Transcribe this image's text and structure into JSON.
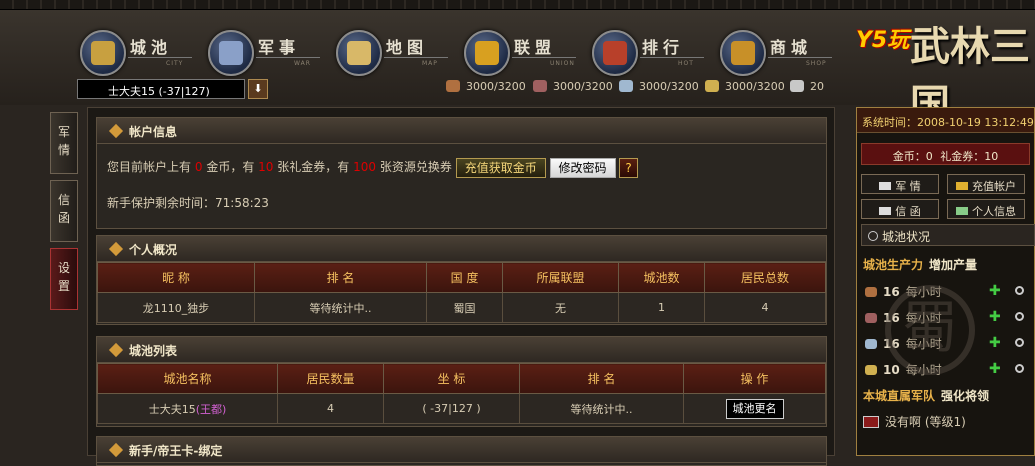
{
  "nav": [
    {
      "label": "城池",
      "sub": "CITY",
      "color": "#c8a040"
    },
    {
      "label": "军事",
      "sub": "WAR",
      "color": "#8aa0c8"
    },
    {
      "label": "地图",
      "sub": "MAP",
      "color": "#d8b868"
    },
    {
      "label": "联盟",
      "sub": "UNION",
      "color": "#d8a020"
    },
    {
      "label": "排行",
      "sub": "HOT",
      "color": "#b8402a"
    },
    {
      "label": "商城",
      "sub": "SHOP",
      "color": "#c89028"
    }
  ],
  "logo": {
    "brand": "Y5玩",
    "title": "武林三国"
  },
  "city_selector": {
    "value": "士大夫15 (-37|127)",
    "button": "⬇"
  },
  "resources": [
    {
      "name": "wood",
      "value": "3000/3200",
      "color": "#b07040"
    },
    {
      "name": "brick",
      "value": "3000/3200",
      "color": "#a06060"
    },
    {
      "name": "iron",
      "value": "3000/3200",
      "color": "#a0b8d0"
    },
    {
      "name": "food",
      "value": "3000/3200",
      "color": "#d0b050"
    },
    {
      "name": "population",
      "value": "20",
      "color": "#c8c8c8"
    }
  ],
  "left_tabs": [
    "军\n情",
    "信\n函",
    "设\n置"
  ],
  "account": {
    "title": "帐户信息",
    "line1_prefix": "您目前帐户上有",
    "gold": "0",
    "line1_a": "金币，有",
    "coupons": "10",
    "line1_b": "张礼金券，有",
    "vouchers": "100",
    "line1_c": "张资源兑换券",
    "recharge_button": "充值获取金币",
    "password_button": "修改密码",
    "help_button": "?",
    "protect_label": "新手保护剩余时间：",
    "protect_time": "71:58:23"
  },
  "personal": {
    "title": "个人概况",
    "headers": [
      "昵  称",
      "排  名",
      "国  度",
      "所属联盟",
      "城池数",
      "居民总数"
    ],
    "row": [
      "龙1110_独步",
      "等待统计中..",
      "蜀国",
      "无",
      "1",
      "4"
    ]
  },
  "cities": {
    "title": "城池列表",
    "headers": [
      "城池名称",
      "居民数量",
      "坐  标",
      "排  名",
      "操  作"
    ],
    "row": {
      "name": "士大夫15",
      "capital": "(王都)",
      "residents": "4",
      "coords": "( -37|127 )",
      "rank": "等待统计中..",
      "action": "城池更名"
    }
  },
  "card": {
    "title": "新手/帝王卡-绑定"
  },
  "right": {
    "time_label": "系统时间：",
    "time": "2008-10-19 13:12:49",
    "gold_label": "金币：",
    "gold": "0",
    "coupon_label": "礼金券：",
    "coupon": "10",
    "buttons": [
      "军  情",
      "充值帐户",
      "信  函",
      "个人信息"
    ],
    "status_title": "城池状况",
    "prod_label": "城池生产力",
    "prod_action": "增加产量",
    "production": [
      {
        "name": "wood",
        "value": "16",
        "unit": "每小时",
        "color": "#b07040"
      },
      {
        "name": "brick",
        "value": "16",
        "unit": "每小时",
        "color": "#a06060"
      },
      {
        "name": "iron",
        "value": "16",
        "unit": "每小时",
        "color": "#a0b8d0"
      },
      {
        "name": "food",
        "value": "10",
        "unit": "每小时",
        "color": "#d0b050"
      }
    ],
    "army_label": "本城直属军队",
    "army_action": "强化将领",
    "army_item": "没有啊 (等级1)",
    "watermark": "蜀"
  }
}
